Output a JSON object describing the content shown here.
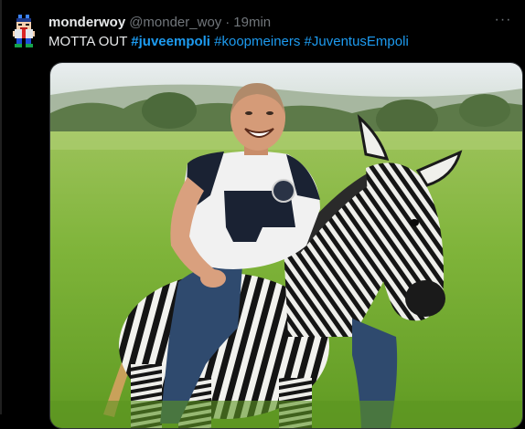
{
  "tweet": {
    "display_name": "monderwoy",
    "handle": "@monder_woy",
    "separator": "·",
    "time": "19min",
    "text_plain": "MOTTA OUT ",
    "hashtags": [
      "#juveempoli",
      "#koopmeiners",
      "#JuventusEmpoli"
    ],
    "more_label": "···"
  },
  "colors": {
    "background": "#000000",
    "text": "#e7e9ea",
    "muted": "#71767b",
    "link": "#1d9bf0"
  },
  "icons": {
    "avatar": "pixel-avatar-icon",
    "more": "more-dots-icon"
  }
}
